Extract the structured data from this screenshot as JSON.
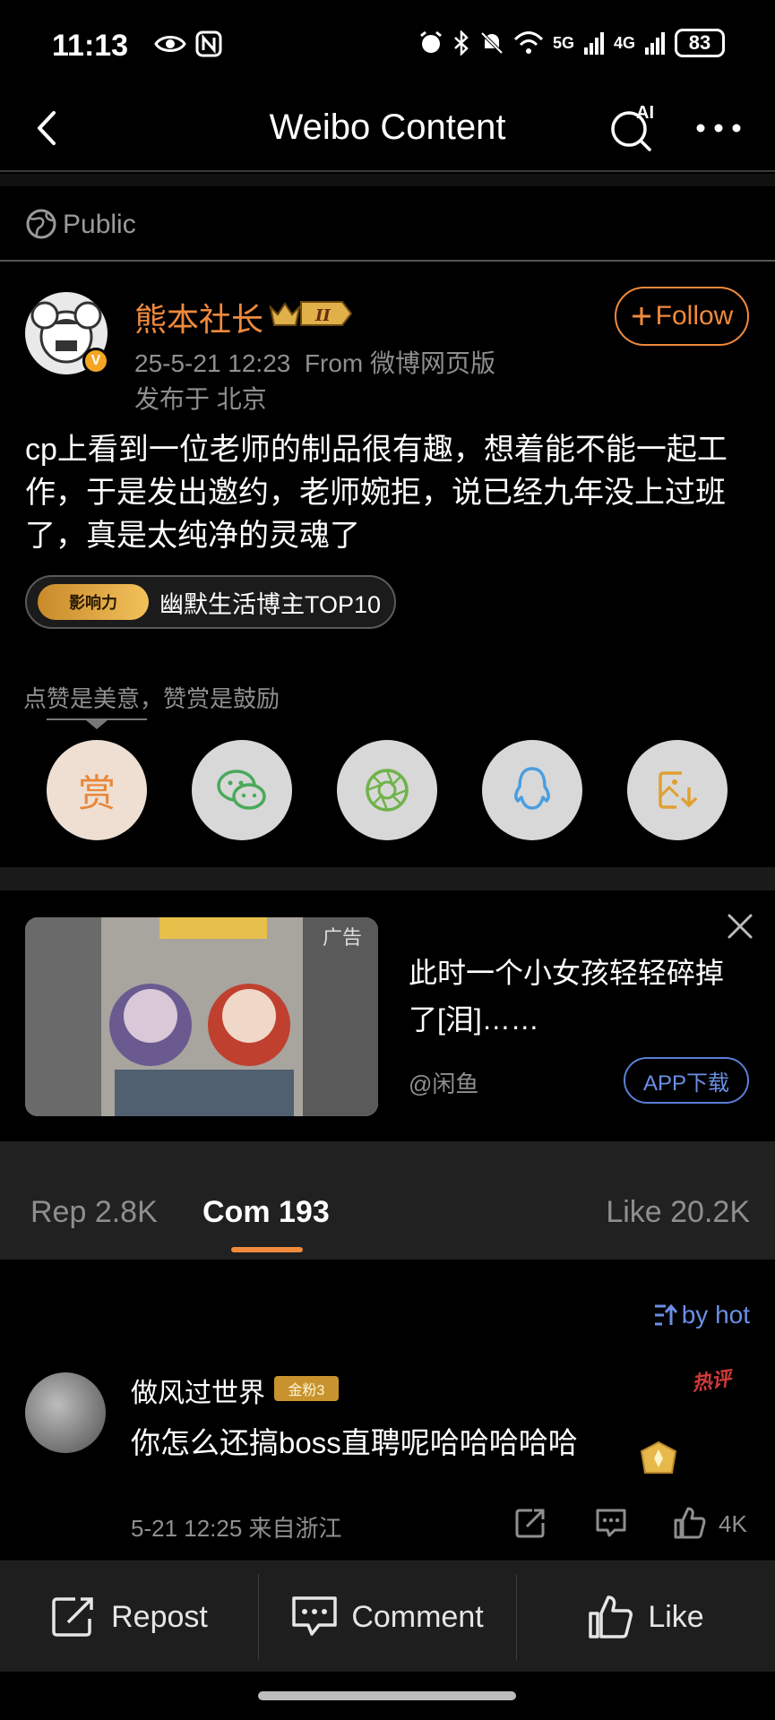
{
  "status_bar": {
    "time": "11:13",
    "battery": "83",
    "signal_1": "5G",
    "signal_2": "4G"
  },
  "nav": {
    "title": "Weibo Content",
    "ai_label": "AI"
  },
  "visibility": "Public",
  "post": {
    "username": "熊本社长",
    "level_badge": "II",
    "verified_mark": "V",
    "time": "25-5-21 12:23",
    "source": "From 微博网页版",
    "location": "发布于 北京",
    "follow_label": "Follow",
    "text": "cp上看到一位老师的制品很有趣，想着能不能一起工作，于是发出邀约，老师婉拒，说已经九年没上过班了，真是太纯净的灵魂了",
    "influence_tag": "影响力",
    "influence_label": "幽默生活博主TOP10"
  },
  "reward": {
    "tip": "点赞是美意，赞赏是鼓励",
    "reward_button": "赏",
    "share_icons": [
      "wechat-icon",
      "moments-icon",
      "qq-icon",
      "save-image-icon"
    ]
  },
  "ad": {
    "tag": "广告",
    "title": "此时一个小女孩轻轻碎掉了[泪]……",
    "source": "@闲鱼",
    "download_label": "APP下载"
  },
  "tabs": {
    "repost": "Rep 2.8K",
    "comments": "Com 193",
    "likes": "Like 20.2K",
    "active": "comments"
  },
  "sort_label": "by hot",
  "comment": {
    "name": "做风过世界",
    "fan_badge": "金粉3",
    "hot_tag": "热评",
    "text": "你怎么还搞boss直聘呢哈哈哈哈哈",
    "time": "5-21 12:25  来自浙江",
    "like_count": "4K"
  },
  "bottom_bar": {
    "repost": "Repost",
    "comment": "Comment",
    "like": "Like"
  },
  "colors": {
    "accent": "#f08a3c",
    "link": "#6b8fe6",
    "background": "#000000"
  }
}
